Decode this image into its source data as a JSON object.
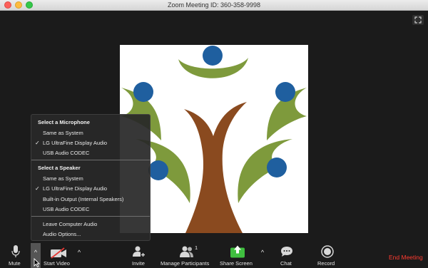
{
  "window": {
    "title": "Zoom Meeting ID: 360-358-9998"
  },
  "shared_content": {
    "icon": "tree-logo-image"
  },
  "audio_menu": {
    "microphone_header": "Select a Microphone",
    "microphone_items": [
      {
        "label": "Same as System",
        "checked": false
      },
      {
        "label": "LG UltraFine Display Audio",
        "checked": true
      },
      {
        "label": "USB Audio CODEC",
        "checked": false
      }
    ],
    "speaker_header": "Select a Speaker",
    "speaker_items": [
      {
        "label": "Same as System",
        "checked": false
      },
      {
        "label": "LG UltraFine Display Audio",
        "checked": true
      },
      {
        "label": "Built-in Output (Internal Speakers)",
        "checked": false
      },
      {
        "label": "USB Audio CODEC",
        "checked": false
      }
    ],
    "leave_audio": "Leave Computer Audio",
    "audio_options": "Audio Options...",
    "check_glyph": "✓"
  },
  "toolbar": {
    "mute": "Mute",
    "start_video": "Start Video",
    "invite": "Invite",
    "manage_participants": "Manage Participants",
    "participant_count": "1",
    "share_screen": "Share Screen",
    "chat": "Chat",
    "record": "Record",
    "end_meeting": "End Meeting",
    "caret": "^"
  },
  "colors": {
    "share_green": "#3fbf3f",
    "end_red": "#ff3b30",
    "tree_brown": "#8a4a1f",
    "leaf_green": "#7e9a3c",
    "dot_blue": "#1f5f9f"
  }
}
